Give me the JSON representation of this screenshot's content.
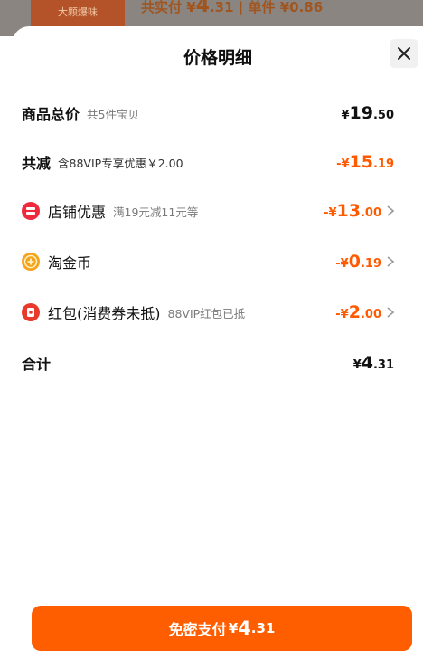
{
  "backdrop": {
    "thumb_text": "大颗爆味",
    "price_text": "共实付 ¥",
    "price_int": "4",
    "price_dec": ".31",
    "unit_text": "| 单件 ¥0.86"
  },
  "sheet": {
    "title": "价格明细",
    "close_label": "×"
  },
  "rows": {
    "total": {
      "label": "商品总价",
      "note": "共5件宝贝",
      "sym": "¥",
      "int": "19",
      "dec": ".50"
    },
    "discount": {
      "label": "共减",
      "note": "含88VIP专享优惠￥2.00",
      "sym": "-¥",
      "int": "15",
      "dec": ".19"
    },
    "shop": {
      "label": "店铺优惠",
      "note": "满19元减11元等",
      "sym": "-¥",
      "int": "13",
      "dec": ".00"
    },
    "coin": {
      "label": "淘金币",
      "sym": "-¥",
      "int": "0",
      "dec": ".19"
    },
    "redpacket": {
      "label": "红包(消费券未抵)",
      "note": "88VIP红包已抵",
      "sym": "-¥",
      "int": "2",
      "dec": ".00"
    },
    "sum": {
      "label": "合计",
      "sym": "¥",
      "int": "4",
      "dec": ".31"
    }
  },
  "pay_button": {
    "label": "免密支付",
    "sym": "¥",
    "int": "4",
    "dec": ".31"
  },
  "colors": {
    "accent": "#ff5e00",
    "price_orange": "#ff5a00",
    "shop_icon": "#ee2a3c",
    "coin_icon": "#f7a21b",
    "redpacket_icon": "#e8392c"
  },
  "icons": [
    "close-icon",
    "shop-coupon-icon",
    "taojinbi-coin-icon",
    "red-packet-icon",
    "chevron-right-icon"
  ]
}
